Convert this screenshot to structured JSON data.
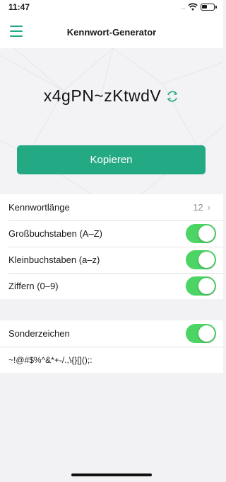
{
  "status_bar": {
    "time": "11:47",
    "signal_dots": "....",
    "icons": [
      "signal-icon",
      "wifi-icon",
      "battery-icon"
    ]
  },
  "nav": {
    "title": "Kennwort-Generator",
    "menu_icon": "hamburger-menu-icon"
  },
  "hero": {
    "password": "x4gPN~zKtwdV",
    "refresh_icon": "refresh-icon",
    "copy_label": "Kopieren"
  },
  "settings": {
    "length": {
      "label": "Kennwortlänge",
      "value": "12",
      "chevron": "›"
    },
    "uppercase": {
      "label": "Großbuchstaben (A–Z)",
      "enabled": true
    },
    "lowercase": {
      "label": "Kleinbuchstaben (a–z)",
      "enabled": true
    },
    "digits": {
      "label": "Ziffern (0–9)",
      "enabled": true
    },
    "special": {
      "label": "Sonderzeichen",
      "enabled": true,
      "characters": "~!@#$%^&*+-/.,\\{}[]();:"
    }
  },
  "colors": {
    "accent": "#24a985",
    "toggle_on": "#4cd464",
    "background": "#f2f2f4"
  }
}
